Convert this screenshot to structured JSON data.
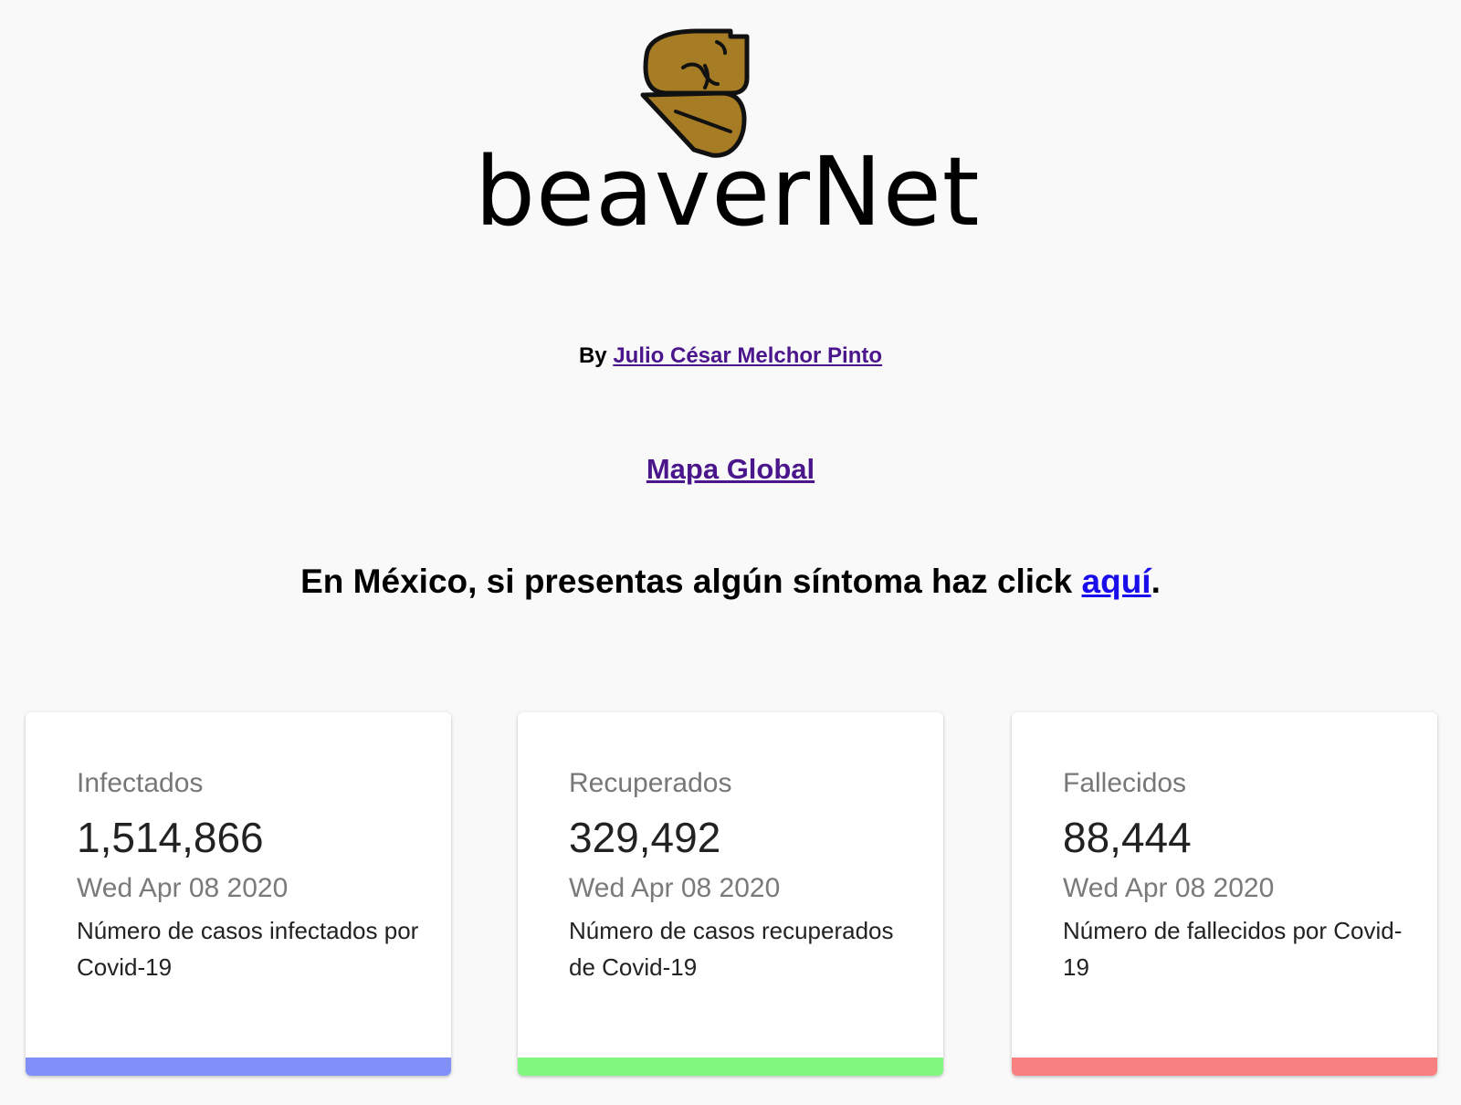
{
  "header": {
    "logo_icon": "beaver-icon",
    "logo_text": "beaverNet"
  },
  "byline": {
    "prefix": "By",
    "author_link": "Julio César Melchor Pinto"
  },
  "global_map": {
    "label": "Mapa Global"
  },
  "notice": {
    "text": "En México, si presentas algún síntoma haz click",
    "link": "aquí",
    "suffix": "."
  },
  "cards": [
    {
      "title": "Infectados",
      "value": "1,514,866",
      "date": "Wed Apr 08 2020",
      "description": "Número de casos infectados por Covid-19",
      "accent": "#8090f8"
    },
    {
      "title": "Recuperados",
      "value": "329,492",
      "date": "Wed Apr 08 2020",
      "description": "Número de casos recuperados de Covid-19",
      "accent": "#80f880"
    },
    {
      "title": "Fallecidos",
      "value": "88,444",
      "date": "Wed Apr 08 2020",
      "description": "Número de fallecidos por Covid-19",
      "accent": "#f88080"
    }
  ],
  "colors": {
    "logo_fill": "#a67c24",
    "visited_link": "#4b168c",
    "link": "#1a0dec"
  }
}
